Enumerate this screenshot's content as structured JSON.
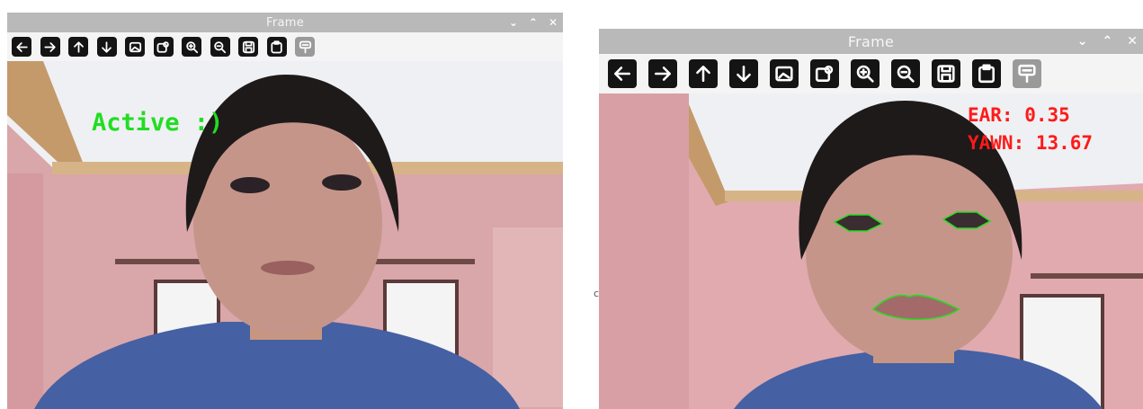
{
  "windows": [
    {
      "title": "Frame",
      "controls": [
        "⌄",
        "⌃",
        "✕"
      ],
      "toolbar": [
        {
          "icon": "arrow-left-icon",
          "label": "Pan left"
        },
        {
          "icon": "arrow-right-icon",
          "label": "Pan right"
        },
        {
          "icon": "arrow-up-icon",
          "label": "Pan up"
        },
        {
          "icon": "arrow-down-icon",
          "label": "Pan down"
        },
        {
          "icon": "image-icon",
          "label": "Fit to window"
        },
        {
          "icon": "image-zoom-icon",
          "label": "Original size"
        },
        {
          "icon": "zoom-in-icon",
          "label": "Zoom in"
        },
        {
          "icon": "zoom-out-icon",
          "label": "Zoom out"
        },
        {
          "icon": "save-icon",
          "label": "Save image"
        },
        {
          "icon": "clipboard-icon",
          "label": "Copy to clipboard"
        },
        {
          "icon": "properties-icon",
          "label": "Properties"
        }
      ],
      "overlay": {
        "status": "Active :)",
        "color": "#22dd22"
      }
    },
    {
      "title": "Frame",
      "controls": [
        "⌄",
        "⌃",
        "✕"
      ],
      "toolbar": [
        {
          "icon": "arrow-left-icon",
          "label": "Pan left"
        },
        {
          "icon": "arrow-right-icon",
          "label": "Pan right"
        },
        {
          "icon": "arrow-up-icon",
          "label": "Pan up"
        },
        {
          "icon": "arrow-down-icon",
          "label": "Pan down"
        },
        {
          "icon": "image-icon",
          "label": "Fit to window"
        },
        {
          "icon": "image-zoom-icon",
          "label": "Original size"
        },
        {
          "icon": "zoom-in-icon",
          "label": "Zoom in"
        },
        {
          "icon": "zoom-out-icon",
          "label": "Zoom out"
        },
        {
          "icon": "save-icon",
          "label": "Save image"
        },
        {
          "icon": "clipboard-icon",
          "label": "Copy to clipboard"
        },
        {
          "icon": "properties-icon",
          "label": "Properties"
        }
      ],
      "overlay": {
        "ear": "EAR: 0.35",
        "yawn": "YAWN: 13.67",
        "color": "#ff1a1a",
        "landmark_color": "#22dd22"
      }
    }
  ],
  "stray_char": "c"
}
